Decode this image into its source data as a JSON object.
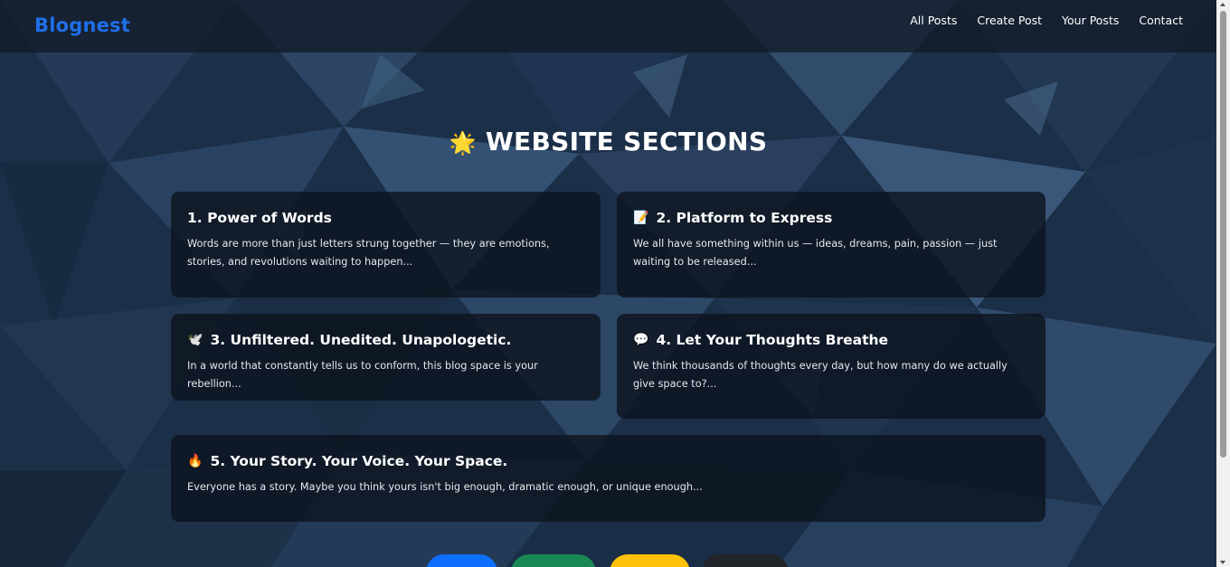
{
  "navbar": {
    "brand": "Blognest",
    "links": [
      "All Posts",
      "Create Post",
      "Your Posts",
      "Contact"
    ]
  },
  "sections": {
    "title": "WEBSITE SECTIONS",
    "title_emoji": "🌟",
    "cards": [
      {
        "emoji": "",
        "title": "1. Power of Words",
        "text": "Words are more than just letters strung together — they are emotions, stories, and revolutions waiting to happen..."
      },
      {
        "emoji": "📝",
        "title": "2. Platform to Express",
        "text": "We all have something within us — ideas, dreams, pain, passion — just waiting to be released..."
      },
      {
        "emoji": "🕊️",
        "title": "3. Unfiltered. Unedited. Unapologetic.",
        "text": "In a world that constantly tells us to conform, this blog space is your rebellion..."
      },
      {
        "emoji": "💬",
        "title": "4. Let Your Thoughts Breathe",
        "text": "We think thousands of thoughts every day, but how many do we actually give space to?..."
      },
      {
        "emoji": "🔥",
        "title": "5. Your Story. Your Voice. Your Space.",
        "text": "Everyone has a story. Maybe you think yours isn't big enough, dramatic enough, or unique enough..."
      }
    ]
  },
  "bottom_buttons": {
    "colors": [
      "#0d6efd",
      "#198754",
      "#ffc107",
      "#212529"
    ]
  },
  "colors": {
    "brand": "#1f6fe8",
    "background": "#1a2c44",
    "card": "#0c121c"
  }
}
